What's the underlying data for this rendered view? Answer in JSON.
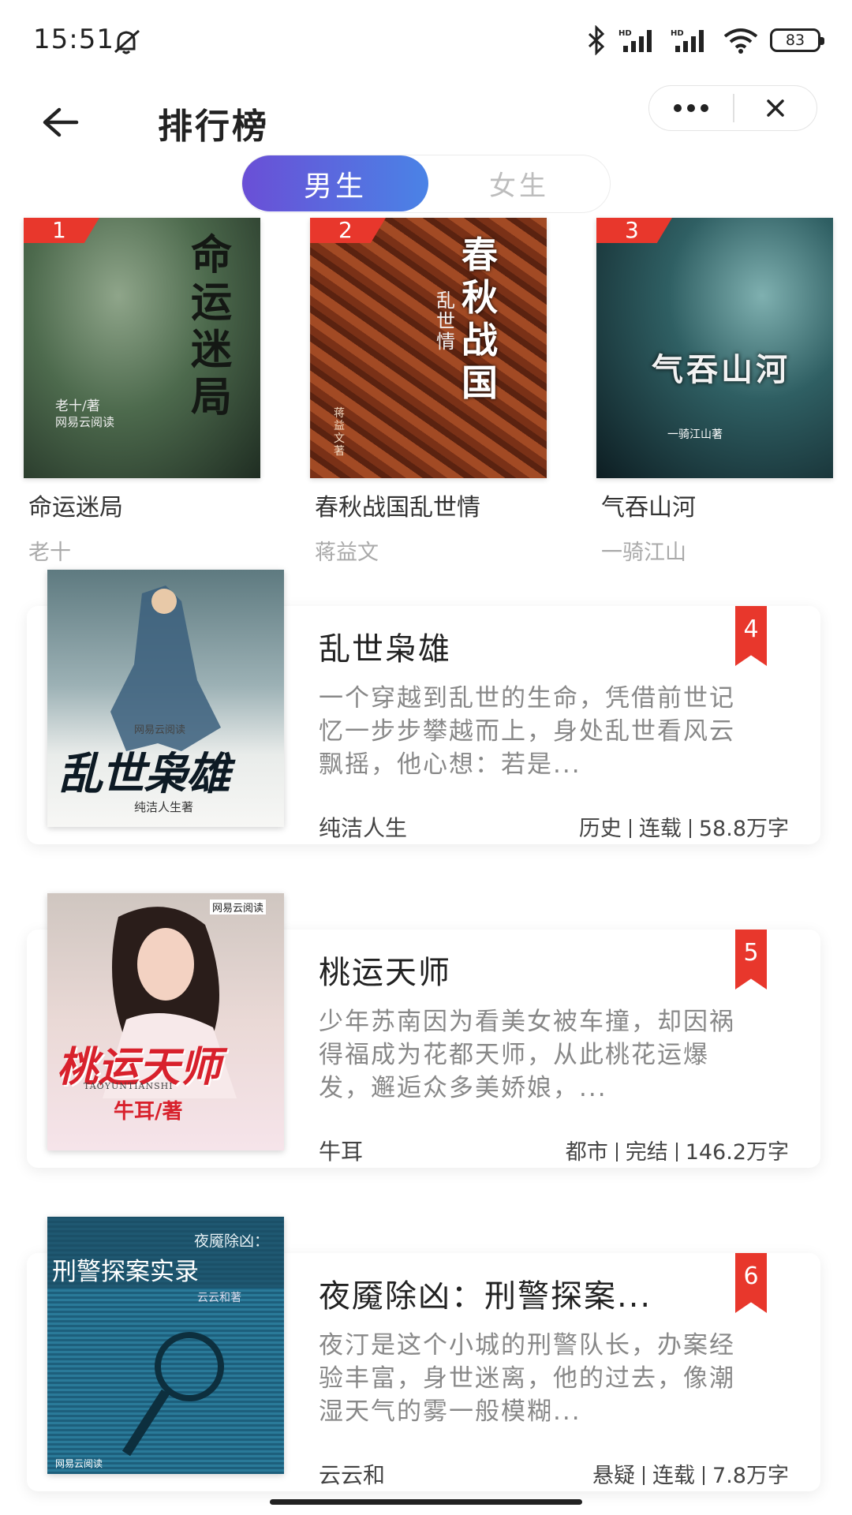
{
  "status_bar": {
    "time": "15:51",
    "battery": "83",
    "icons": [
      "mute-icon",
      "bluetooth-icon",
      "signal-icon",
      "signal-icon",
      "wifi-icon",
      "battery-icon"
    ]
  },
  "nav": {
    "title": "排行榜",
    "back_icon": "arrow-left-icon",
    "more_icon": "more-dots-icon",
    "close_icon": "close-icon"
  },
  "gender_tabs": [
    {
      "label": "男生",
      "selected": true
    },
    {
      "label": "女生",
      "selected": false
    }
  ],
  "accent_colors": {
    "rank_red": "#e8372c",
    "tab_gradient_start": "#6a4fd6",
    "tab_gradient_end": "#4a83e6"
  },
  "top3": [
    {
      "rank": "1",
      "title": "命运迷局",
      "author": "老十",
      "cover_text": [
        "命运迷局",
        "老十/著",
        "网易云阅读"
      ]
    },
    {
      "rank": "2",
      "title": "春秋战国乱世情",
      "author": "蒋益文",
      "cover_text": [
        "春秋战国",
        "乱世情",
        "蒋益文著"
      ]
    },
    {
      "rank": "3",
      "title": "气吞山河",
      "author": "一骑江山",
      "cover_text": [
        "气吞山河",
        "一骑江山著"
      ]
    }
  ],
  "list": [
    {
      "rank": "4",
      "title": "乱世枭雄",
      "desc": "一个穿越到乱世的生命，凭借前世记忆一步步攀越而上，身处乱世看风云飘摇，他心想：若是...",
      "author": "纯洁人生",
      "genre": "历史",
      "status": "连载",
      "words": "58.8万字",
      "cover_text": [
        "网易云阅读",
        "乱世枭雄",
        "纯洁人生著"
      ]
    },
    {
      "rank": "5",
      "title": "桃运天师",
      "desc": "少年苏南因为看美女被车撞，却因祸得福成为花都天师，从此桃花运爆发，邂逅众多美娇娘，...",
      "author": "牛耳",
      "genre": "都市",
      "status": "完结",
      "words": "146.2万字",
      "cover_text": [
        "网易云阅读",
        "桃运天师",
        "TAOYUNTIANSHI",
        "牛耳/著"
      ]
    },
    {
      "rank": "6",
      "title": "夜魇除凶：刑警探案...",
      "desc": "夜汀是这个小城的刑警队长，办案经验丰富，身世迷离，他的过去，像潮湿天气的雾一般模糊...",
      "author": "云云和",
      "genre": "悬疑",
      "status": "连载",
      "words": "7.8万字",
      "cover_text": [
        "夜魇除凶：",
        "刑警探案实录",
        "云云和著",
        "网易云阅读"
      ]
    }
  ]
}
